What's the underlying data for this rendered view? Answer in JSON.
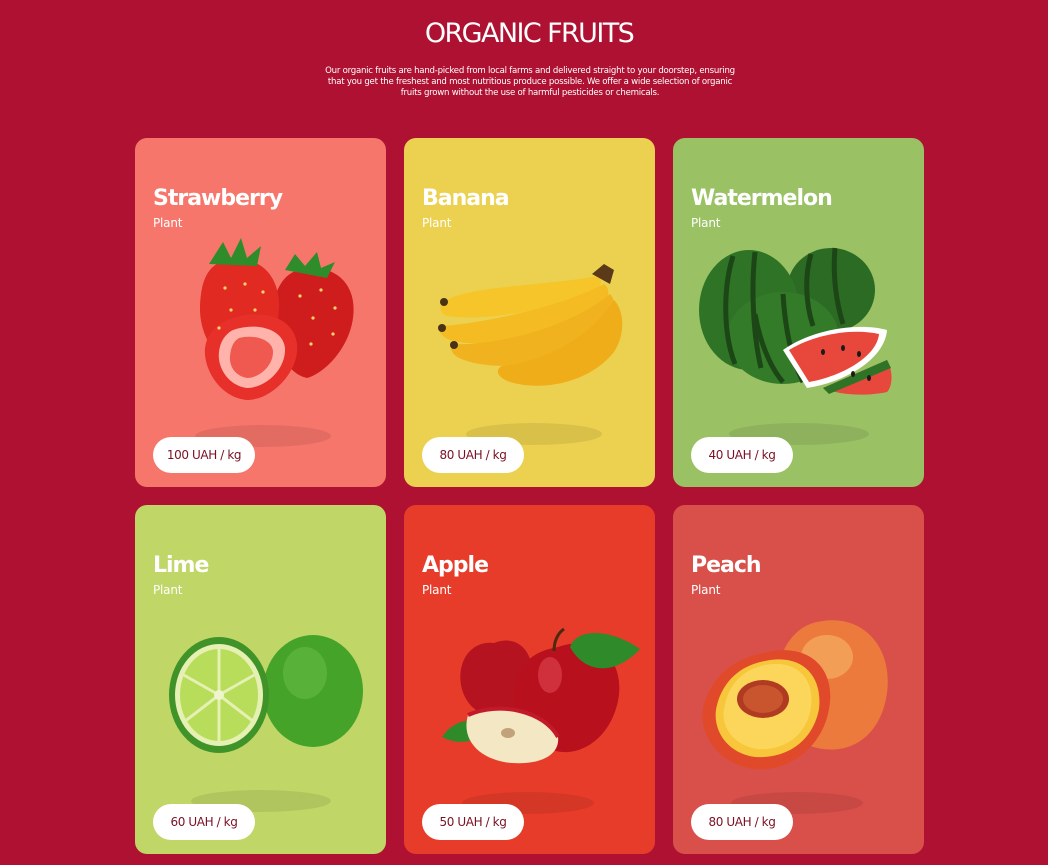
{
  "header": {
    "title": "ORGANIC FRUITS",
    "description": "Our organic fruits are hand-picked from local farms and delivered straight to your doorstep, ensuring that you get the freshest and most nutritious produce possible. We offer a wide selection of organic fruits grown without the use of harmful pesticides or chemicals."
  },
  "colors": {
    "page_background": "#ae1131",
    "price_text": "#7a1024"
  },
  "cards": [
    {
      "name": "Strawberry",
      "type": "Plant",
      "price": "100 UAH / kg",
      "color": "#f7766b",
      "icon": "strawberry-icon"
    },
    {
      "name": "Banana",
      "type": "Plant",
      "price": "80 UAH / kg",
      "color": "#ecd150",
      "icon": "banana-icon"
    },
    {
      "name": "Watermelon",
      "type": "Plant",
      "price": "40 UAH / kg",
      "color": "#9bc165",
      "icon": "watermelon-icon"
    },
    {
      "name": "Lime",
      "type": "Plant",
      "price": "60 UAH / kg",
      "color": "#c0d666",
      "icon": "lime-icon"
    },
    {
      "name": "Apple",
      "type": "Plant",
      "price": "50 UAH / kg",
      "color": "#e83c2b",
      "icon": "apple-icon"
    },
    {
      "name": "Peach",
      "type": "Plant",
      "price": "80 UAH / kg",
      "color": "#d9504a",
      "icon": "peach-icon"
    }
  ]
}
